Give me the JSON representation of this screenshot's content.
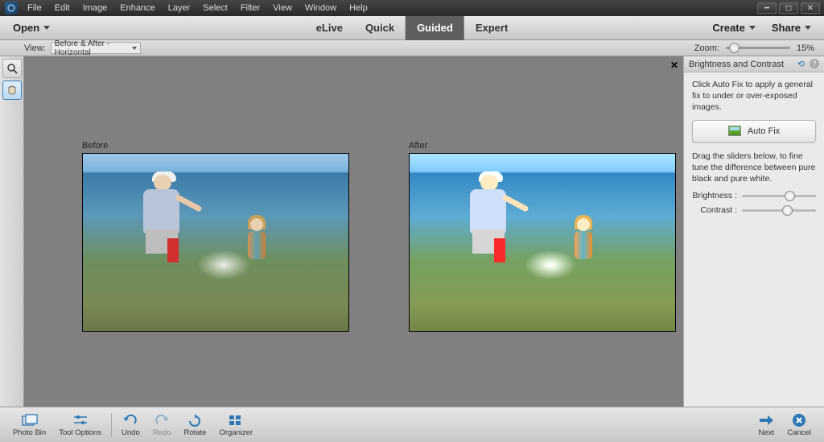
{
  "menus": [
    "File",
    "Edit",
    "Image",
    "Enhance",
    "Layer",
    "Select",
    "Filter",
    "View",
    "Window",
    "Help"
  ],
  "toolbar": {
    "open": "Open",
    "create": "Create",
    "share": "Share"
  },
  "modes": {
    "elive": "eLive",
    "quick": "Quick",
    "guided": "Guided",
    "expert": "Expert"
  },
  "options": {
    "view_label": "View:",
    "view_value": "Before & After - Horizontal",
    "zoom_label": "Zoom:",
    "zoom_value": "15%"
  },
  "compare": {
    "before": "Before",
    "after": "After"
  },
  "panel": {
    "title": "Brightness and Contrast",
    "auto_help": "Click Auto Fix to apply a general fix to under or over-exposed images.",
    "autofix": "Auto Fix",
    "slider_help": "Drag the sliders below, to fine tune the difference between pure black and pure white.",
    "brightness": "Brightness :",
    "contrast": "Contrast :",
    "brightness_val": 58,
    "contrast_val": 54
  },
  "bottom": {
    "photobin": "Photo Bin",
    "tooloptions": "Tool Options",
    "undo": "Undo",
    "redo": "Redo",
    "rotate": "Rotate",
    "organizer": "Organizer",
    "next": "Next",
    "cancel": "Cancel"
  }
}
